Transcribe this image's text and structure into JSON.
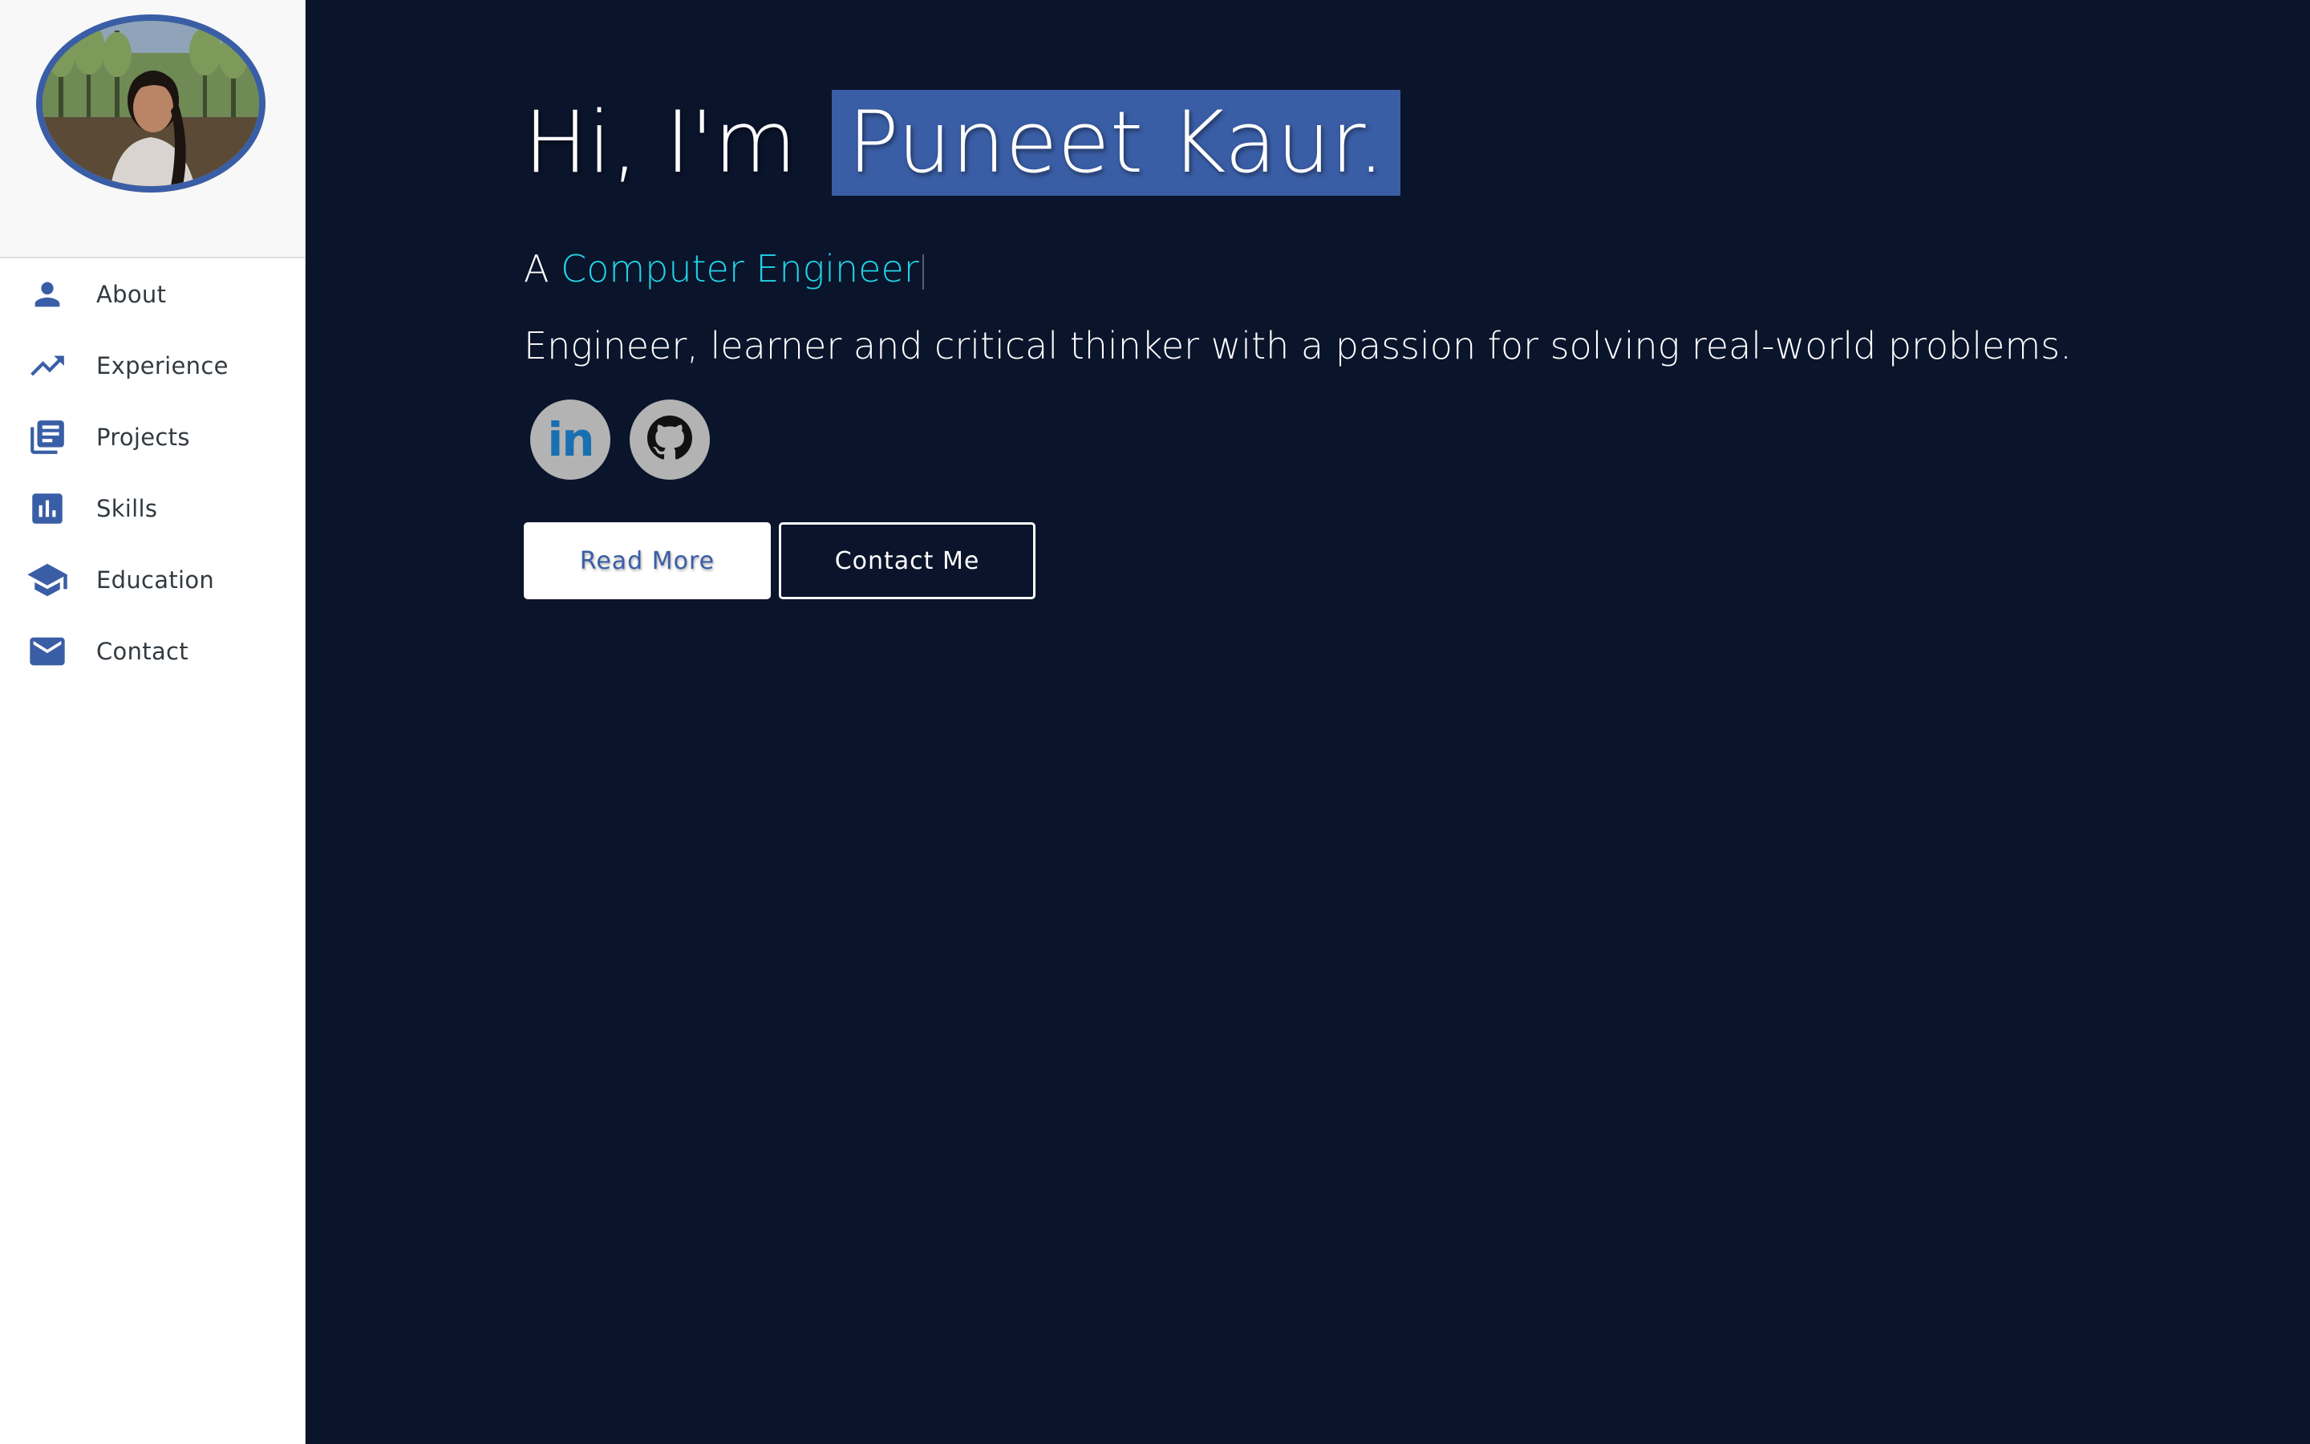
{
  "sidebar": {
    "items": [
      {
        "label": "About",
        "icon": "person-icon"
      },
      {
        "label": "Experience",
        "icon": "trending-up-icon"
      },
      {
        "label": "Projects",
        "icon": "library-books-icon"
      },
      {
        "label": "Skills",
        "icon": "bar-chart-icon"
      },
      {
        "label": "Education",
        "icon": "school-icon"
      },
      {
        "label": "Contact",
        "icon": "mail-icon"
      }
    ]
  },
  "hero": {
    "greeting": "Hi, I'm",
    "name": "Puneet Kaur.",
    "tagline_prefix": "A",
    "role": "Computer Engineer",
    "bio": "Engineer, learner and critical thinker with a passion for solving real-world problems."
  },
  "social": {
    "linkedin_text": "in",
    "linkedin_icon": "linkedin-icon",
    "github_icon": "github-icon"
  },
  "buttons": {
    "read_more": "Read More",
    "contact_me": "Contact Me"
  },
  "colors": {
    "accent": "#3a5ea6",
    "background": "#0a142b",
    "role_highlight": "#22d3e6",
    "sidebar_bg": "#ffffff"
  }
}
